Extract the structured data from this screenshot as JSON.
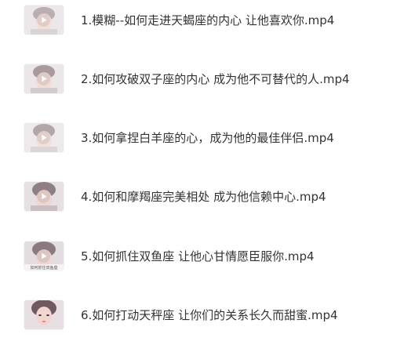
{
  "icon": "play-icon",
  "items": [
    {
      "title": "1.模糊--如何走进天蝎座的内心 让他喜欢你.mp4",
      "thumb_icon": "video-thumbnail",
      "thumb_caption": ""
    },
    {
      "title": "2.如何攻破双子座的内心 成为他不可替代的人.mp4",
      "thumb_icon": "video-thumbnail",
      "thumb_caption": ""
    },
    {
      "title": "3.如何拿捏白羊座的心，成为他的最佳伴侣.mp4",
      "thumb_icon": "video-thumbnail",
      "thumb_caption": ""
    },
    {
      "title": "4.如何和摩羯座完美相处 成为他信赖中心.mp4",
      "thumb_icon": "video-thumbnail",
      "thumb_caption": ""
    },
    {
      "title": "5.如何抓住双鱼座 让他心甘情愿臣服你.mp4",
      "thumb_icon": "video-thumbnail",
      "thumb_caption": "如何抓住双鱼座"
    },
    {
      "title": "6.如何打动天秤座 让你们的关系长久而甜蜜.mp4",
      "thumb_icon": "video-thumbnail",
      "thumb_caption": ""
    }
  ]
}
